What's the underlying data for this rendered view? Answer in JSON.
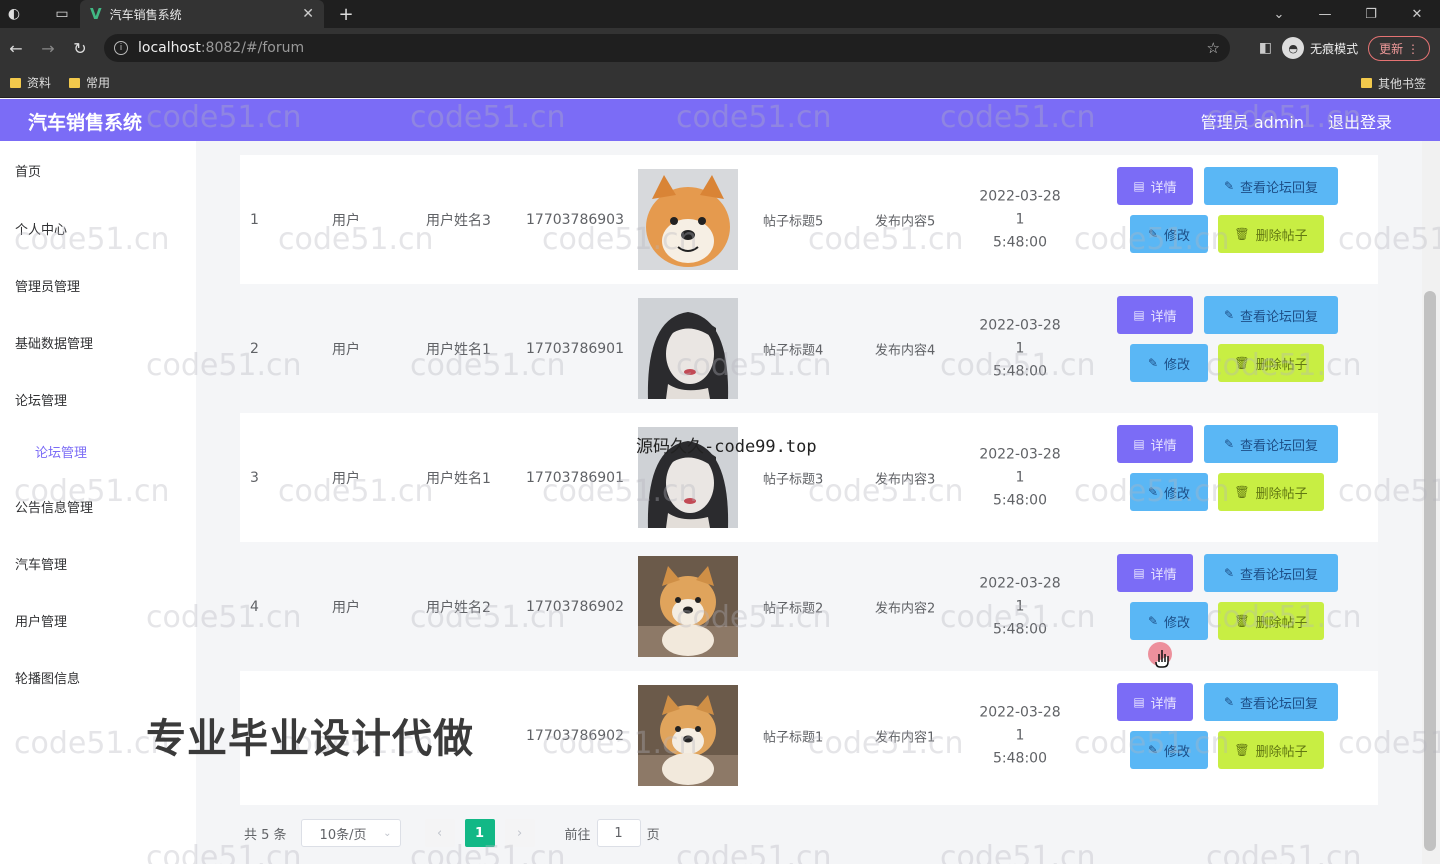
{
  "browser": {
    "tab_title": "汽车销售系统",
    "url_host": "localhost",
    "url_path": ":8082/#/forum",
    "incognito_label": "无痕模式",
    "update_label": "更新",
    "bookmarks": [
      "资料",
      "常用"
    ],
    "other_bookmarks": "其他书签"
  },
  "header": {
    "title": "汽车销售系统",
    "user": "管理员 admin",
    "logout": "退出登录"
  },
  "sidebar": {
    "items": [
      "首页",
      "个人中心",
      "管理员管理",
      "基础数据管理",
      "论坛管理",
      "公告信息管理",
      "汽车管理",
      "用户管理",
      "轮播图信息"
    ],
    "sub_item": "论坛管理"
  },
  "table": {
    "rows": [
      {
        "index": "1",
        "type": "用户",
        "name": "用户姓名3",
        "phone": "17703786903",
        "title": "帖子标题5",
        "content": "发布内容5",
        "time": "2022-03-28 15:48:00",
        "image": "dog-smile"
      },
      {
        "index": "2",
        "type": "用户",
        "name": "用户姓名1",
        "phone": "17703786901",
        "title": "帖子标题4",
        "content": "发布内容4",
        "time": "2022-03-28 15:48:00",
        "image": "girl"
      },
      {
        "index": "3",
        "type": "用户",
        "name": "用户姓名1",
        "phone": "17703786901",
        "title": "帖子标题3",
        "content": "发布内容3",
        "time": "2022-03-28 15:48:00",
        "image": "girl"
      },
      {
        "index": "4",
        "type": "用户",
        "name": "用户姓名2",
        "phone": "17703786902",
        "title": "帖子标题2",
        "content": "发布内容2",
        "time": "2022-03-28 15:48:00",
        "image": "puppy"
      },
      {
        "index": "",
        "type": "",
        "name": "",
        "phone": "17703786902",
        "title": "帖子标题1",
        "content": "发布内容1",
        "time": "2022-03-28 15:48:00",
        "image": "puppy"
      }
    ],
    "buttons": {
      "detail": "详情",
      "reply": "查看论坛回复",
      "edit": "修改",
      "delete": "删除帖子"
    }
  },
  "pagination": {
    "total": "共 5 条",
    "page_size": "10条/页",
    "current": "1",
    "goto_prefix": "前往",
    "goto_value": "1",
    "goto_suffix": "页"
  },
  "overlay": {
    "source_text": "源码久久-code99.top",
    "promo_text": "专业毕业设计代做",
    "watermark": "code51.cn"
  },
  "colors": {
    "header": "#7b6cf6",
    "detail_button": "#7b6cf6",
    "reply_button": "#5ab7f5",
    "delete_button": "#c8ee43",
    "active_page": "#12b886"
  }
}
